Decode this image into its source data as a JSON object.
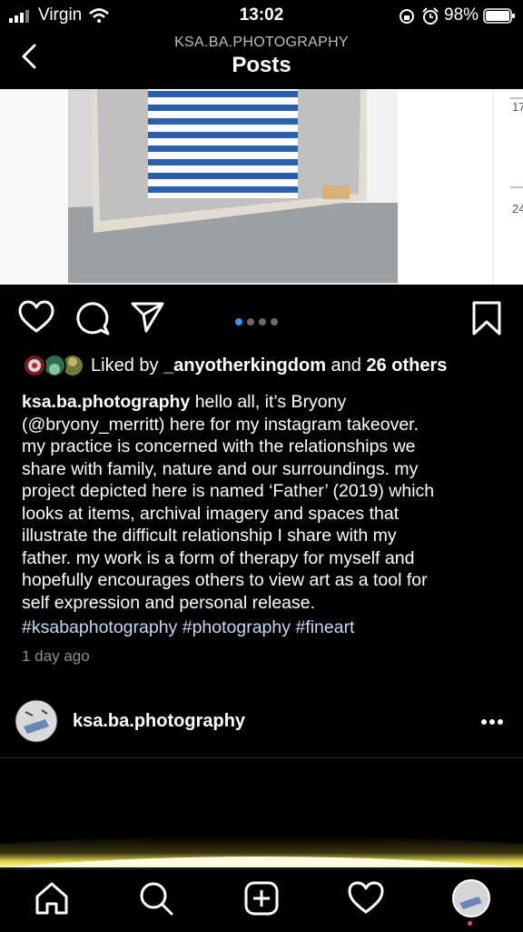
{
  "status_bar": {
    "carrier": "Virgin",
    "time": "13:02",
    "battery": "98%"
  },
  "header": {
    "subtitle": "KSA.BA.PHOTOGRAPHY",
    "title": "Posts"
  },
  "photo": {
    "ruler_marks": [
      "17",
      "24"
    ]
  },
  "carousel": {
    "pages": 4,
    "active": 1
  },
  "likes": {
    "prefix": "Liked by ",
    "user": "_anyotherkingdom",
    "middle": " and ",
    "others": "26 others"
  },
  "caption": {
    "username": "ksa.ba.photography",
    "lines": [
      " hello all, it’s Bryony",
      "(@bryony_merritt) here for my instagram takeover.",
      "my practice is concerned with the relationships we",
      "share with family, nature and our surroundings. my",
      "project depicted here is named ‘Father’ (2019) which",
      "looks at items, archival imagery and spaces that",
      "illustrate the difficult relationship I share with my",
      "father. my work is a form of therapy for myself and",
      "hopefully encourages others to view art as a tool for",
      "self expression and personal release."
    ],
    "hashtags": [
      "#ksabaphotography",
      "#photography",
      "#fineart"
    ]
  },
  "timestamp": "1 day ago",
  "next_post": {
    "username": "ksa.ba.photography"
  },
  "colors": {
    "accent": "#3897f0",
    "notification": "#ed4956",
    "hashtag": "#c6d8f6"
  }
}
